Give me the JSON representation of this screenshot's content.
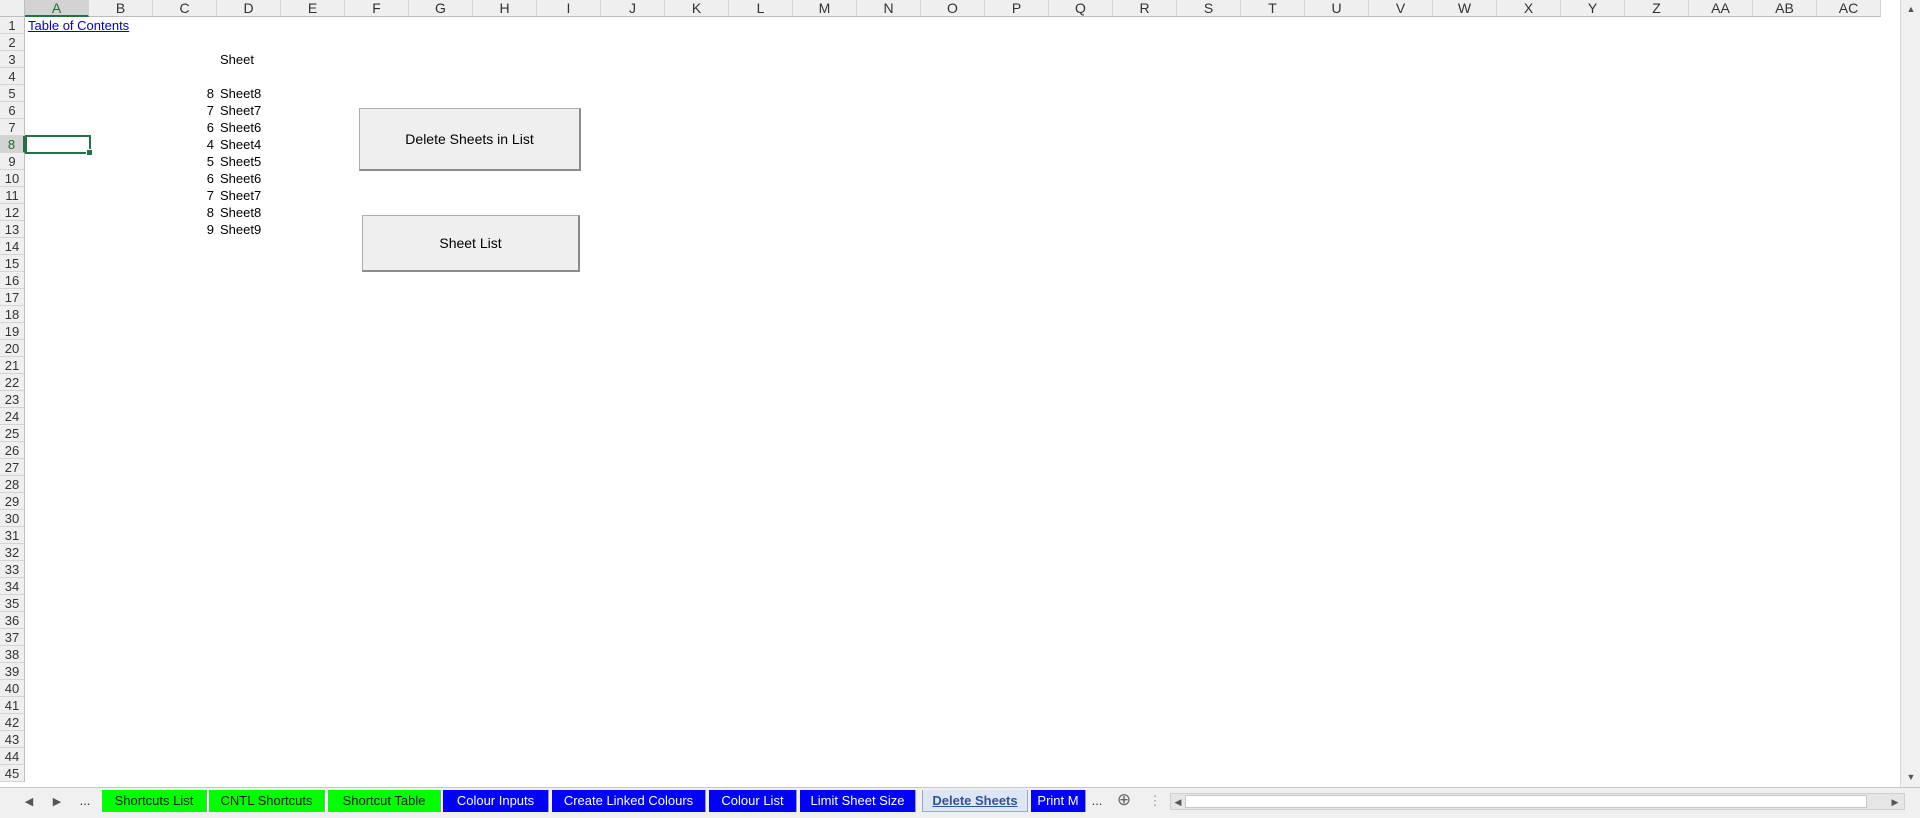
{
  "columns": [
    "A",
    "B",
    "C",
    "D",
    "E",
    "F",
    "G",
    "H",
    "I",
    "J",
    "K",
    "L",
    "M",
    "N",
    "O",
    "P",
    "Q",
    "R",
    "S",
    "T",
    "U",
    "V",
    "W",
    "X",
    "Y",
    "Z",
    "AA",
    "AB",
    "AC"
  ],
  "rows": [
    "1",
    "2",
    "3",
    "4",
    "5",
    "6",
    "7",
    "8",
    "9",
    "10",
    "11",
    "12",
    "13",
    "14",
    "15",
    "16",
    "17",
    "18",
    "19",
    "20",
    "21",
    "22",
    "23",
    "24",
    "25",
    "26",
    "27",
    "28",
    "29",
    "30",
    "31",
    "32",
    "33",
    "34",
    "35",
    "36",
    "37",
    "38",
    "39",
    "40",
    "41",
    "42",
    "43",
    "44",
    "45"
  ],
  "active_cell": {
    "column": "A",
    "row": "8"
  },
  "cells": {
    "toc_link": "Table of Contents",
    "sheet_header": "Sheet",
    "sheet_list": [
      {
        "num": "8",
        "name": "Sheet8"
      },
      {
        "num": "7",
        "name": "Sheet7"
      },
      {
        "num": "6",
        "name": "Sheet6"
      },
      {
        "num": "4",
        "name": "Sheet4"
      },
      {
        "num": "5",
        "name": "Sheet5"
      },
      {
        "num": "6",
        "name": "Sheet6"
      },
      {
        "num": "7",
        "name": "Sheet7"
      },
      {
        "num": "8",
        "name": "Sheet8"
      },
      {
        "num": "9",
        "name": "Sheet9"
      }
    ]
  },
  "buttons": {
    "delete_sheets": "Delete Sheets in List",
    "sheet_list": "Sheet List"
  },
  "tabbar": {
    "prev_icon": "◀",
    "next_icon": "▶",
    "more_left": "...",
    "more_right": "...",
    "add_icon": "⊕",
    "tabs": [
      {
        "label": "Shortcuts List",
        "color": "green"
      },
      {
        "label": "CNTL Shortcuts",
        "color": "green"
      },
      {
        "label": "Shortcut Table",
        "color": "green"
      },
      {
        "label": "Colour Inputs",
        "color": "blue"
      },
      {
        "label": "Create Linked Colours",
        "color": "blue"
      },
      {
        "label": "Colour List",
        "color": "blue"
      },
      {
        "label": "Limit Sheet Size",
        "color": "blue"
      },
      {
        "label": "Delete Sheets",
        "color": "active"
      },
      {
        "label": "Print M",
        "color": "blue"
      }
    ]
  },
  "colors": {
    "green_tab": "#00ff00",
    "blue_tab": "#0000ff",
    "selection": "#217346"
  }
}
